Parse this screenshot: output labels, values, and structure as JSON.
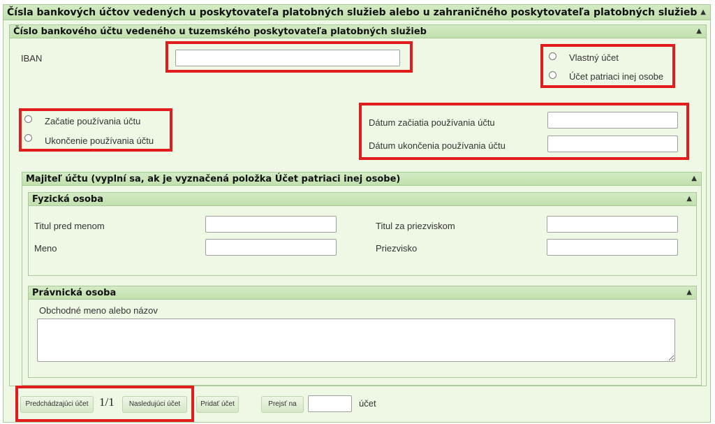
{
  "main": {
    "title": "Čísla bankových účtov vedených u poskytovateľa platobných služieb alebo u zahraničného poskytovateľa platobných služieb"
  },
  "domestic": {
    "title": "Číslo bankového účtu vedeného u tuzemského poskytovateľa platobných služieb",
    "iban_label": "IBAN",
    "iban_value": "",
    "radio_own": "Vlastný účet",
    "radio_other": "Účet patriaci inej osobe",
    "radio_start": "Začatie používania účtu",
    "radio_end": "Ukončenie používania účtu",
    "date_start_label": "Dátum začiatia používania účtu",
    "date_end_label": "Dátum ukončenia používania účtu"
  },
  "owner": {
    "title": "Majiteľ účtu (vyplní sa, ak je vyznačená položka Účet patriaci inej osobe)",
    "person": {
      "title": "Fyzická osoba",
      "title_before_label": "Titul pred menom",
      "title_after_label": "Titul za priezviskom",
      "first_name_label": "Meno",
      "last_name_label": "Priezvisko"
    },
    "company": {
      "title": "Právnická osoba",
      "name_label": "Obchodné meno alebo názov"
    }
  },
  "nav": {
    "prev_label": "Predchádzajúci účet",
    "page_indicator": "1/1",
    "next_label": "Nasledujúci účet",
    "add_label": "Pridať účet",
    "goto_label": "Prejsť na",
    "goto_value": "",
    "account_word": "účet"
  },
  "colors": {
    "panel_bg": "#eef8e4",
    "header_bg": "#c8e4b5",
    "highlight": "#e01c1c"
  },
  "icons": {
    "collapse": "chevron-up-icon"
  }
}
